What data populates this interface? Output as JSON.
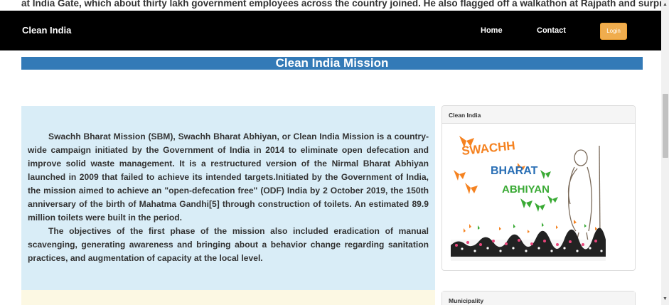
{
  "overflow_text": "at India Gate, which about thirty lakh government employees across the country joined. He also flagged off a walkathon at Rajpath and surprised",
  "navbar": {
    "brand": "Clean India",
    "home": "Home",
    "contact": "Contact",
    "login": "Login"
  },
  "mission_title": "Clean India Mission",
  "main": {
    "paragraph1": "Swachh Bharat Mission (SBM), Swachh Bharat Abhiyan, or Clean India Mission is a country-wide campaign initiated by the Government of India in 2014 to eliminate open defecation and improve solid waste management. It is a restructured version of the Nirmal Bharat Abhiyan launched in 2009 that failed to achieve its intended targets.Initiated by the Government of India, the mission aimed to achieve an \"open-defecation free\" (ODF) India by 2 October 2019, the 150th anniversary of the birth of Mahatma Gandhi[5] through construction of toilets. An estimated 89.9 million toilets were built in the period.",
    "paragraph2": "The objectives of the first phase of the mission also included eradication of manual scavenging, generating awareness and bringing about a behavior change regarding sanitation practices, and augmentation of capacity at the local level."
  },
  "sidebar": {
    "panel1_heading": "Clean India",
    "panel2_heading": "Municipality"
  },
  "logo": {
    "word1": "SWACHH",
    "word2": "BHARAT",
    "word3": "ABHIYAN"
  },
  "colors": {
    "navbar": "#000000",
    "mission_bar": "#337ab7",
    "info_panel": "#d9edf7",
    "warning_panel": "#fcf8e3",
    "login_button": "#f0ad4e",
    "butterfly_orange": "#f58220",
    "butterfly_green": "#3aaa35",
    "logo_blue": "#2a6fb5"
  },
  "icons": {
    "scroll_up": "arrow-up-icon",
    "scroll_down": "arrow-down-icon"
  }
}
